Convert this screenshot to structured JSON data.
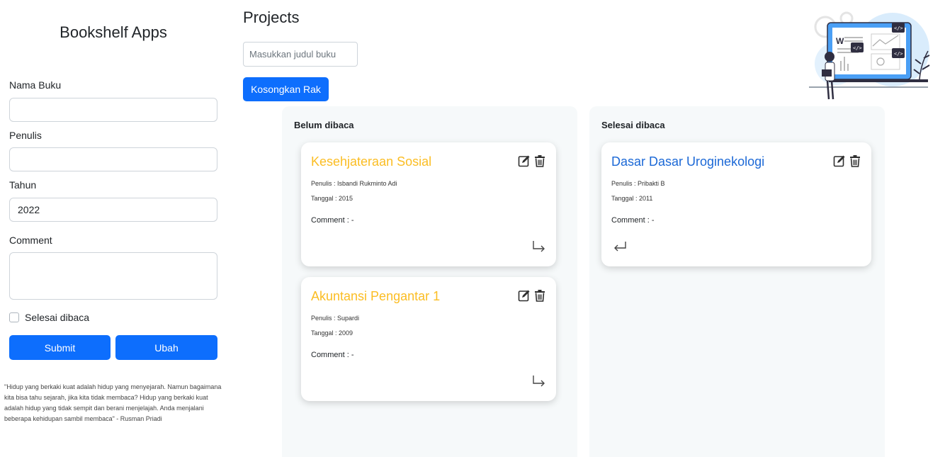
{
  "app": {
    "title": "Bookshelf Apps"
  },
  "form": {
    "name_label": "Nama Buku",
    "name_value": "",
    "author_label": "Penulis",
    "author_value": "",
    "year_label": "Tahun",
    "year_value": "2022",
    "comment_label": "Comment",
    "comment_value": "",
    "finished_label": "Selesai dibaca",
    "finished_checked": false,
    "submit_label": "Submit",
    "edit_label": "Ubah"
  },
  "quote": "\"Hidup yang berkaki kuat adalah hidup yang menyejarah. Namun bagaimana kita bisa tahu sejarah, jika kita tidak membaca? Hidup yang berkaki kuat adalah hidup yang tidak sempit dan berani menjelajah. Anda menjalani beberapa kehidupan sambil membaca\" - Rusman Priadi",
  "main": {
    "title": "Projects",
    "search_placeholder": "Masukkan judul buku",
    "clear_label": "Kosongkan Rak"
  },
  "shelves": {
    "unread": {
      "title": "Belum dibaca",
      "books": [
        {
          "title": "Kesehjateraan Sosial",
          "author": "Penulis : Isbandi Rukminto Adi",
          "date": "Tanggal : 2015",
          "comment": "Comment : -"
        },
        {
          "title": "Akuntansi Pengantar 1",
          "author": "Penulis : Supardi",
          "date": "Tanggal : 2009",
          "comment": "Comment : -"
        }
      ]
    },
    "read": {
      "title": "Selesai dibaca",
      "books": [
        {
          "title": "Dasar Dasar Uroginekologi",
          "author": "Penulis : Pribakti B",
          "date": "Tanggal : 2011",
          "comment": "Comment : -"
        }
      ]
    }
  },
  "colors": {
    "primary": "#0d6efd",
    "unread_title": "#fbbd23",
    "read_title": "#1b68d6",
    "shelf_bg": "#f6f9fa"
  }
}
